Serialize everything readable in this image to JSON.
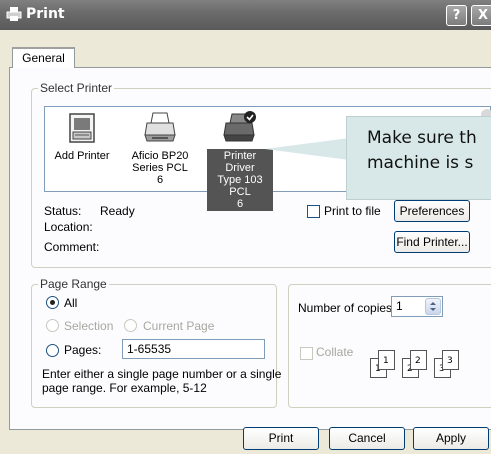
{
  "window": {
    "title": "Print",
    "help_label": "?",
    "close_label": "X"
  },
  "tabs": [
    {
      "label": "General"
    }
  ],
  "select_printer": {
    "group_title": "Select Printer",
    "printers": [
      {
        "label_lines": [
          "Add Printer"
        ],
        "icon": "add-printer-icon",
        "selected": false
      },
      {
        "label_lines": [
          "Aficio BP20",
          "Series PCL 6"
        ],
        "icon": "printer-icon",
        "selected": false
      },
      {
        "label_lines": [
          "Printer Driver",
          "Type 103 PCL",
          "6"
        ],
        "icon": "default-printer-icon",
        "selected": true
      }
    ],
    "status_label": "Status:",
    "status_value": "Ready",
    "location_label": "Location:",
    "comment_label": "Comment:",
    "print_to_file_label": "Print to file",
    "preferences_label": "Preferences",
    "find_printer_label": "Find Printer..."
  },
  "callout": {
    "line1": "Make sure th",
    "line2": "machine is s"
  },
  "page_range": {
    "group_title": "Page Range",
    "all_label": "All",
    "selection_label": "Selection",
    "current_page_label": "Current Page",
    "pages_label": "Pages:",
    "pages_value": "1-65535",
    "hint_line1": "Enter either a single page number or a single",
    "hint_line2": "page range.  For example, 5-12",
    "selected_option": "All"
  },
  "copies": {
    "number_label": "Number of copies:",
    "number_value": "1",
    "collate_label": "Collate",
    "collate_pages": [
      "1",
      "1",
      "2",
      "2",
      "3",
      "3"
    ]
  },
  "footer": {
    "print_label": "Print",
    "cancel_label": "Cancel",
    "apply_label": "Apply"
  },
  "colors": {
    "titlebar": "#6c6c6c",
    "selected_item": "#545454",
    "callout_bg": "#d8e8e8",
    "dialog_bg": "#ece9d8"
  }
}
